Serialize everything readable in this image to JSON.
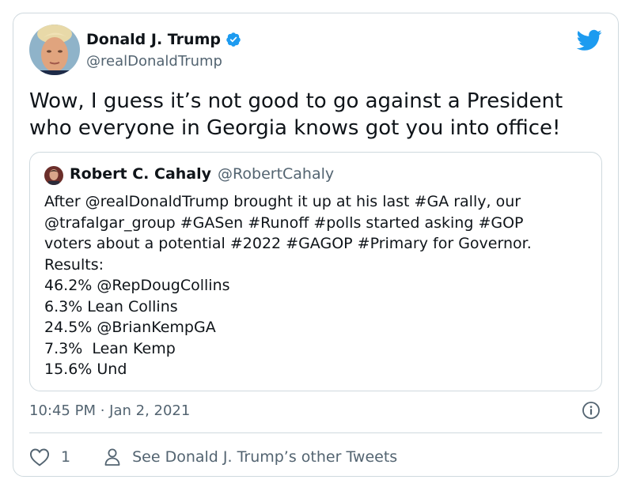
{
  "author": {
    "name": "Donald J. Trump",
    "handle": "@realDonaldTrump",
    "verified": true,
    "avatar_icon": "avatar-photo"
  },
  "tweet": {
    "text": "Wow, I guess it’s not good to go against a President who everyone in Georgia knows got you into office!"
  },
  "quoted_tweet": {
    "name": "Robert C. Cahaly",
    "handle": "@RobertCahaly",
    "lines": [
      "After @realDonaldTrump brought it up at his last #GA rally, our",
      "@trafalgar_group #GASen #Runoff #polls started asking #GOP",
      "voters about a potential #2022 #GAGOP #Primary for Governor.",
      "Results:",
      "46.2% @RepDougCollins",
      "6.3% Lean Collins",
      "24.5% @BrianKempGA",
      "7.3%  Lean Kemp",
      "15.6% Und"
    ]
  },
  "meta": {
    "timestamp": "10:45 PM · Jan 2, 2021"
  },
  "footer": {
    "likes": "1",
    "see_other": "See Donald J. Trump’s other Tweets"
  },
  "colors": {
    "accent": "#1d9bf0",
    "text": "#0f1419",
    "secondary": "#536471",
    "border": "#cfd9de"
  }
}
